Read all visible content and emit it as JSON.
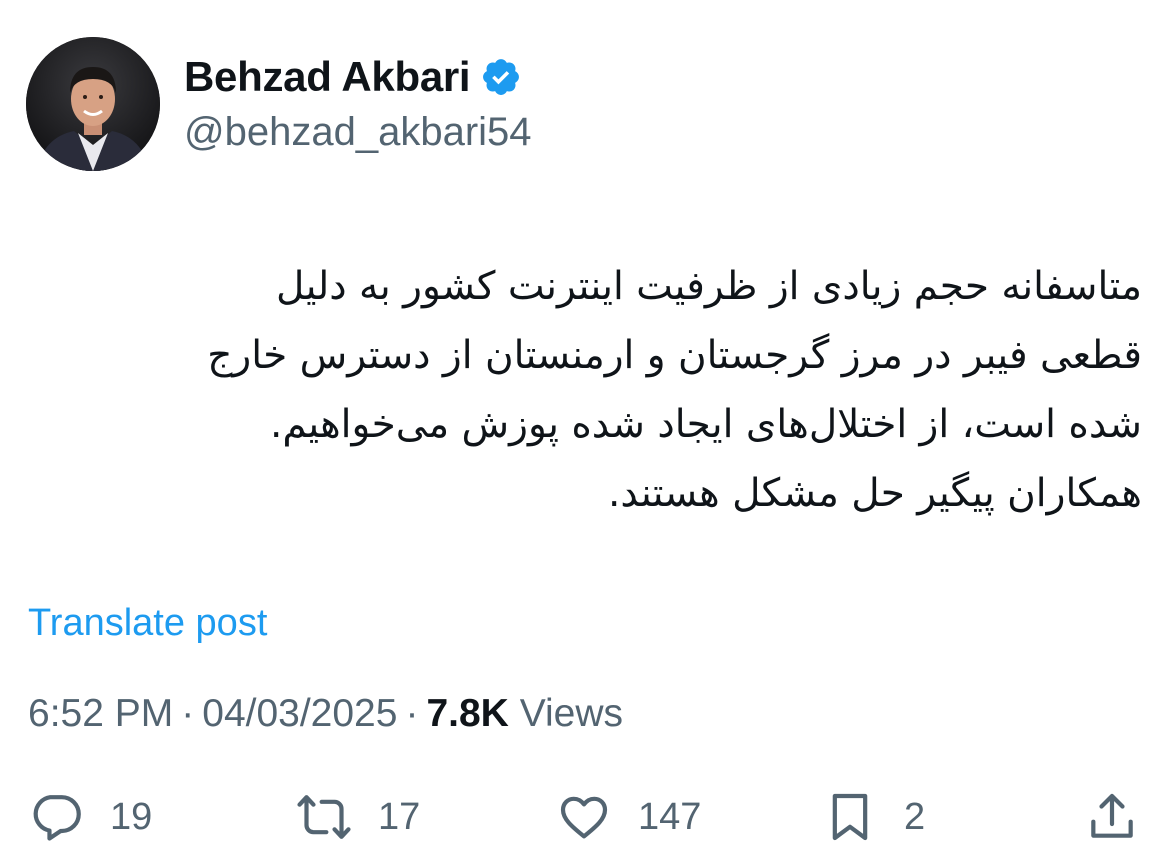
{
  "author": {
    "display_name": "Behzad Akbari",
    "handle": "@behzad_akbari54",
    "verified": true
  },
  "post": {
    "text_lines": [
      "متاسفانه حجم زیادی از ظرفیت اینترنت کشور به دلیل",
      "قطعی فیبر در مرز گرجستان و ارمنستان از دسترس خارج",
      "شده است، از اختلال‌های ایجاد شده پوزش می‌خواهیم.",
      "همکاران پیگیر حل مشکل هستند."
    ],
    "translate_label": "Translate post"
  },
  "meta": {
    "time": "6:52 PM",
    "date": "04/03/2025",
    "views_count": "7.8K",
    "views_label": "Views",
    "separator": "·"
  },
  "actions": {
    "replies": "19",
    "reposts": "17",
    "likes": "147",
    "bookmarks": "2"
  },
  "colors": {
    "accent": "#1d9bf0",
    "text_primary": "#0f1419",
    "text_secondary": "#536471"
  },
  "icons": {
    "verified": "verified-badge-icon",
    "reply": "reply-icon",
    "repost": "repost-icon",
    "like": "heart-icon",
    "bookmark": "bookmark-icon",
    "share": "share-icon"
  }
}
